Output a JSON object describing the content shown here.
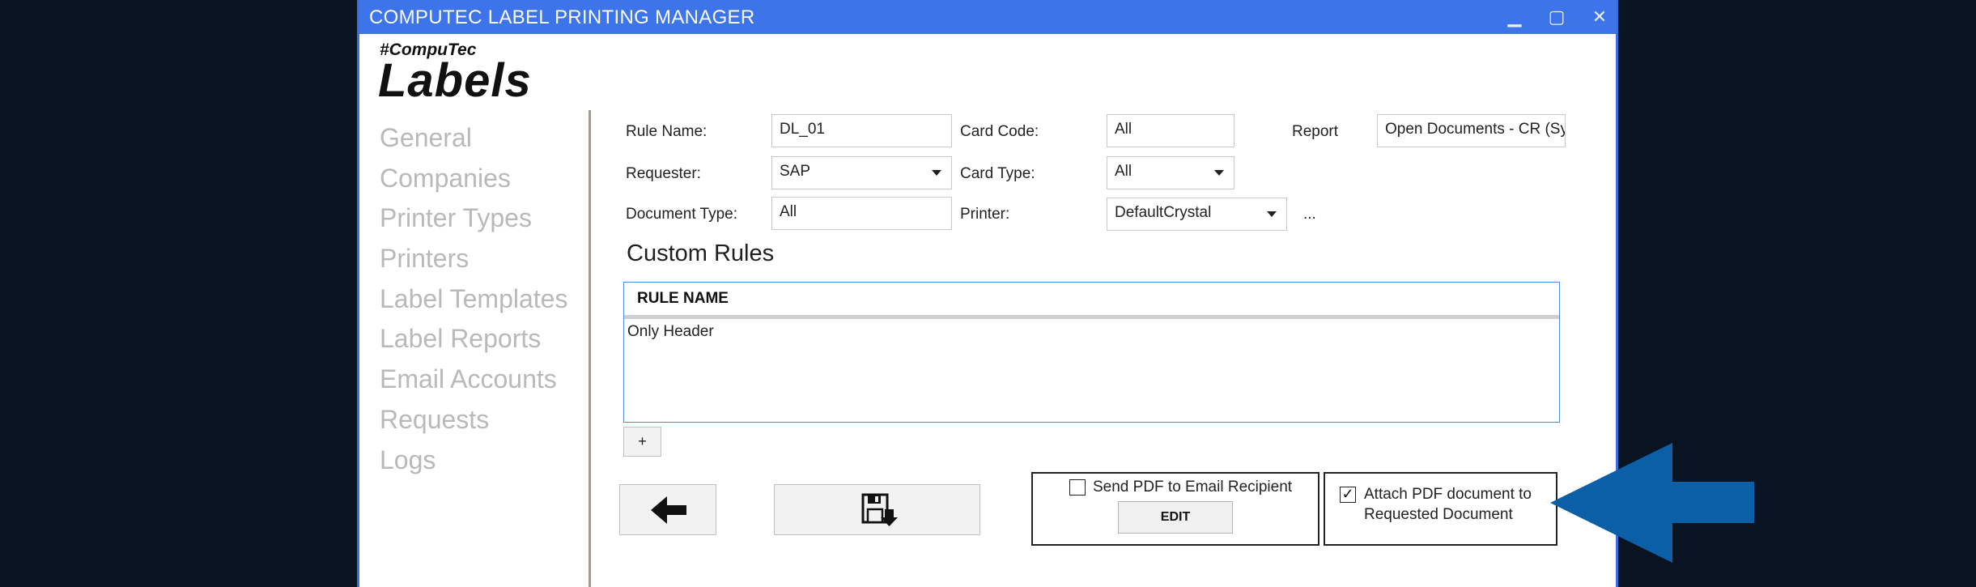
{
  "window": {
    "title": "COMPUTEC LABEL PRINTING MANAGER",
    "controls": {
      "minimize": "▁",
      "maximize": "▢",
      "close": "✕"
    }
  },
  "logo": {
    "tag": "#CompuTec",
    "main": "Labels"
  },
  "sidebar": {
    "items": [
      {
        "label": "General"
      },
      {
        "label": "Companies"
      },
      {
        "label": "Printer Types"
      },
      {
        "label": "Printers"
      },
      {
        "label": "Label Templates"
      },
      {
        "label": "Label Reports"
      },
      {
        "label": "Email Accounts"
      },
      {
        "label": "Requests"
      },
      {
        "label": "Logs"
      }
    ]
  },
  "form": {
    "rule_name": {
      "label": "Rule Name:",
      "value": "DL_01"
    },
    "requester": {
      "label": "Requester:",
      "value": "SAP"
    },
    "document_type": {
      "label": "Document Type:",
      "value": "All"
    },
    "card_code": {
      "label": "Card Code:",
      "value": "All"
    },
    "card_type": {
      "label": "Card Type:",
      "value": "All"
    },
    "printer": {
      "label": "Printer:",
      "value": "DefaultCrystal"
    },
    "report": {
      "label": "Report",
      "value": "Open Documents - CR (Sys"
    },
    "printer_more": "..."
  },
  "custom_rules": {
    "title": "Custom Rules",
    "column_header": "RULE NAME",
    "rows": [
      {
        "name": "Only Header"
      }
    ],
    "add_label": "+"
  },
  "email_box": {
    "label": "Send PDF to Email Recipient",
    "checked": false,
    "edit_label": "EDIT"
  },
  "attach_box": {
    "line1": "Attach PDF document to",
    "line2": "Requested Document",
    "checked": true,
    "check_mark": "✓"
  },
  "colors": {
    "titlebar": "#3d74ea",
    "accent_arrow": "#0a5fa7",
    "nav_text": "#b9b9b9",
    "background": "#0a1322"
  }
}
